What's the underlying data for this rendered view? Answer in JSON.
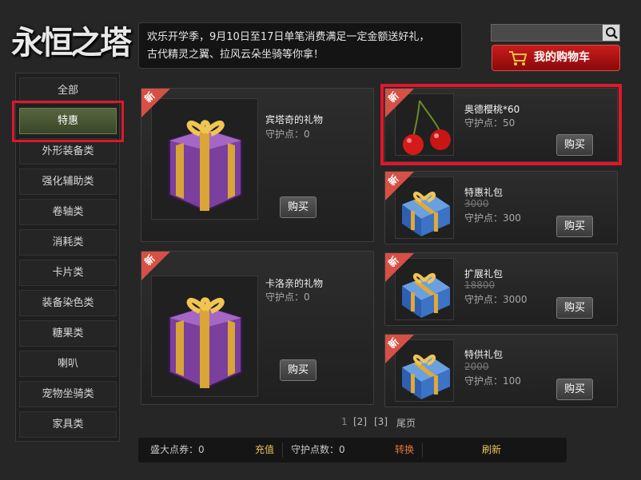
{
  "logo": {
    "text": "永恒之塔"
  },
  "notice": {
    "line1": "欢乐开学季，9月10日至17日单笔消费满足一定金额送好礼，",
    "line2": "古代精灵之翼、拉风云朵坐骑等你拿！"
  },
  "search": {
    "value": "",
    "icon": "search-icon"
  },
  "cart": {
    "label": "我的购物车",
    "icon": "shopping-cart-icon"
  },
  "categories": [
    {
      "label": "全部"
    },
    {
      "label": "特惠"
    },
    {
      "label": "外形装备类"
    },
    {
      "label": "强化辅助类"
    },
    {
      "label": "卷轴类"
    },
    {
      "label": "消耗类"
    },
    {
      "label": "卡片类"
    },
    {
      "label": "装备染色类"
    },
    {
      "label": "糖果类"
    },
    {
      "label": "喇叭"
    },
    {
      "label": "宠物坐骑类"
    },
    {
      "label": "家具类"
    }
  ],
  "active_category": "特惠",
  "products": [
    {
      "badge": "新",
      "name": "宾塔奇的礼物",
      "price": "守护点：0",
      "buy": "购买",
      "icon": "purple-gift-box-icon"
    },
    {
      "badge": "新",
      "name": "卡洛亲的礼物",
      "price": "守护点：0",
      "buy": "购买",
      "icon": "purple-gift-box-icon"
    },
    {
      "badge": "新",
      "name": "奥德樱桃*60",
      "price": "守护点：50",
      "buy": "购买",
      "icon": "cherry-icon"
    },
    {
      "badge": "新",
      "name": "特惠礼包",
      "old_price": "3000",
      "price": "守护点：300",
      "buy": "购买",
      "icon": "blue-gift-box-icon"
    },
    {
      "badge": "新",
      "name": "扩展礼包",
      "old_price": "18800",
      "price": "守护点：3000",
      "buy": "购买",
      "icon": "blue-gift-box-icon"
    },
    {
      "badge": "新",
      "name": "特供礼包",
      "old_price": "2000",
      "price": "守护点：100",
      "buy": "购买",
      "icon": "blue-gift-box-icon"
    }
  ],
  "pagination": {
    "current": "1",
    "p2": "[2]",
    "p3": "[3]",
    "last": "尾页"
  },
  "footer": {
    "coupons": "盛大点券：0",
    "recharge": "充值",
    "guard_points": "守护点数：0",
    "convert": "转换",
    "refresh": "刷新"
  },
  "colors": {
    "highlight": "#e0172b",
    "ribbon": "#d65045",
    "link_yellow": "#e8c65a",
    "convert_orange": "#e8743a"
  }
}
